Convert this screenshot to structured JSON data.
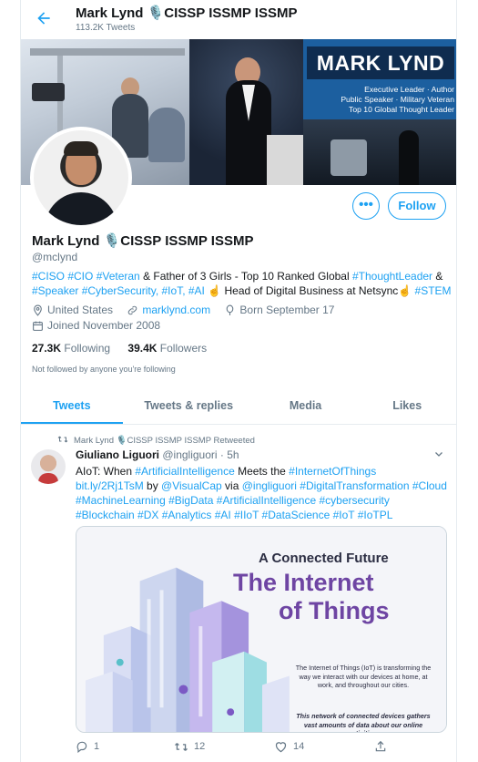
{
  "header": {
    "title": "Mark Lynd 🎙️CISSP ISSMP ISSMP",
    "tweet_count": "113.2K Tweets"
  },
  "banner": {
    "name_panel": "MARK LYND",
    "tagline": "Executive Leader · Author\nPublic Speaker · Military Veteran\nTop 10 Global Thought Leader"
  },
  "actions": {
    "more_label": "•••",
    "follow_label": "Follow"
  },
  "profile": {
    "name": "Mark Lynd 🎙️CISSP ISSMP ISSMP",
    "handle": "@mclynd",
    "bio": [
      {
        "t": "#CISO #CIO #Veteran",
        "link": true
      },
      {
        "t": " & Father of 3 Girls - Top 10 Ranked Global ",
        "link": false
      },
      {
        "t": "#ThoughtLeader",
        "link": true
      },
      {
        "t": " &",
        "link": false
      },
      {
        "t": "\n",
        "link": false
      },
      {
        "t": "#Speaker #CyberSecurity, #IoT, #AI",
        "link": true
      },
      {
        "t": " ☝️ Head of Digital Business at Netsync☝️ ",
        "link": false
      },
      {
        "t": "#STEM",
        "link": true
      }
    ],
    "location": "United States",
    "website": "marklynd.com",
    "birthday": "Born September 17",
    "joined": "Joined November 2008",
    "following_count": "27.3K",
    "following_label": "Following",
    "followers_count": "39.4K",
    "followers_label": "Followers",
    "not_followed": "Not followed by anyone you're following"
  },
  "tabs": [
    {
      "label": "Tweets",
      "active": true
    },
    {
      "label": "Tweets & replies",
      "active": false
    },
    {
      "label": "Media",
      "active": false
    },
    {
      "label": "Likes",
      "active": false
    }
  ],
  "tweet": {
    "retweeted_by": "Mark Lynd 🎙️CISSP ISSMP ISSMP Retweeted",
    "author_name": "Giuliano Liguori",
    "author_handle": "@ingliguori",
    "time": "· 5h",
    "text_parts": [
      {
        "t": "AIoT: When ",
        "link": false
      },
      {
        "t": "#ArtificialIntelligence",
        "link": true
      },
      {
        "t": " Meets the ",
        "link": false
      },
      {
        "t": "#InternetOfThings",
        "link": true
      },
      {
        "t": "\n",
        "link": false
      },
      {
        "t": "bit.ly/2Rj1TsM",
        "link": true
      },
      {
        "t": " by ",
        "link": false
      },
      {
        "t": "@VisualCap",
        "link": true
      },
      {
        "t": " via ",
        "link": false
      },
      {
        "t": "@ingliguori #DigitalTransformation #Cloud",
        "link": true
      },
      {
        "t": "\n",
        "link": false
      },
      {
        "t": "#MachineLearning #BigData #ArtificialIntelligence #cybersecurity",
        "link": true
      },
      {
        "t": "\n",
        "link": false
      },
      {
        "t": "#Blockchain #DX #Analytics #AI #IIoT #DataScience #IoT #IoTPL",
        "link": true
      }
    ],
    "card": {
      "title1": "A Connected Future",
      "title2": "The Internet",
      "title3": "of Things",
      "body": "The Internet of Things (IoT) is transforming the way we interact with our devices at home, at work, and throughout our cities.",
      "body2": "This network of connected devices gathers vast amounts of data about our online activities."
    },
    "reply_count": "1",
    "retweet_count": "12",
    "like_count": "14"
  },
  "colors": {
    "accent": "#1da1f2",
    "muted": "#657786",
    "card_purple": "#6e45a3"
  }
}
